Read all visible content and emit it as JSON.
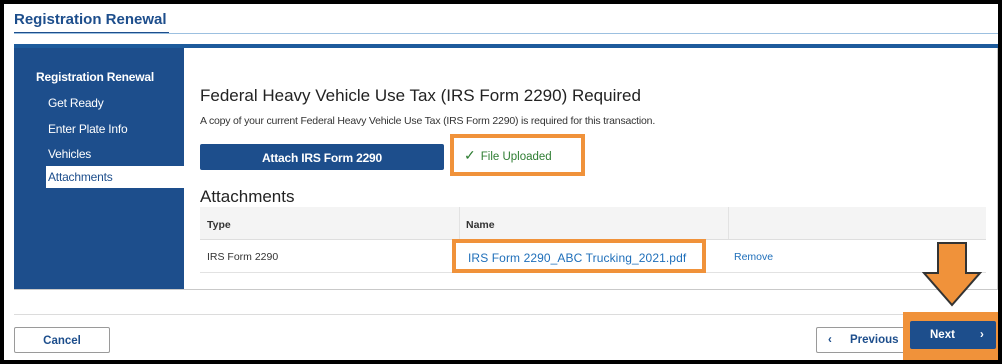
{
  "header": {
    "title": "Registration Renewal"
  },
  "sidebar": {
    "heading": "Registration Renewal",
    "items": [
      {
        "label": "Get Ready"
      },
      {
        "label": "Enter Plate Info"
      },
      {
        "label": "Vehicles"
      },
      {
        "label": "Attachments",
        "active": true
      }
    ]
  },
  "main": {
    "title": "Federal Heavy Vehicle Use Tax (IRS Form 2290) Required",
    "intro": "A copy of your current Federal Heavy Vehicle Use Tax (IRS Form 2290) is required for this transaction.",
    "attach_button": "Attach IRS Form 2290",
    "upload_status": "File Uploaded",
    "attachments_heading": "Attachments",
    "table": {
      "columns": [
        "Type",
        "Name"
      ],
      "rows": [
        {
          "type": "IRS Form 2290",
          "name": "IRS Form 2290_ABC Trucking_2021.pdf",
          "action": "Remove"
        }
      ]
    }
  },
  "footer": {
    "cancel": "Cancel",
    "previous": "Previous",
    "next": "Next"
  },
  "colors": {
    "brand": "#1d4e8c",
    "highlight": "#f0923a",
    "success": "#2e7d32",
    "link": "#1f6fba"
  },
  "icons": {
    "upload_status": "check-icon",
    "previous": "chevron-left-icon",
    "next": "chevron-right-icon",
    "callout": "down-arrow-icon"
  }
}
